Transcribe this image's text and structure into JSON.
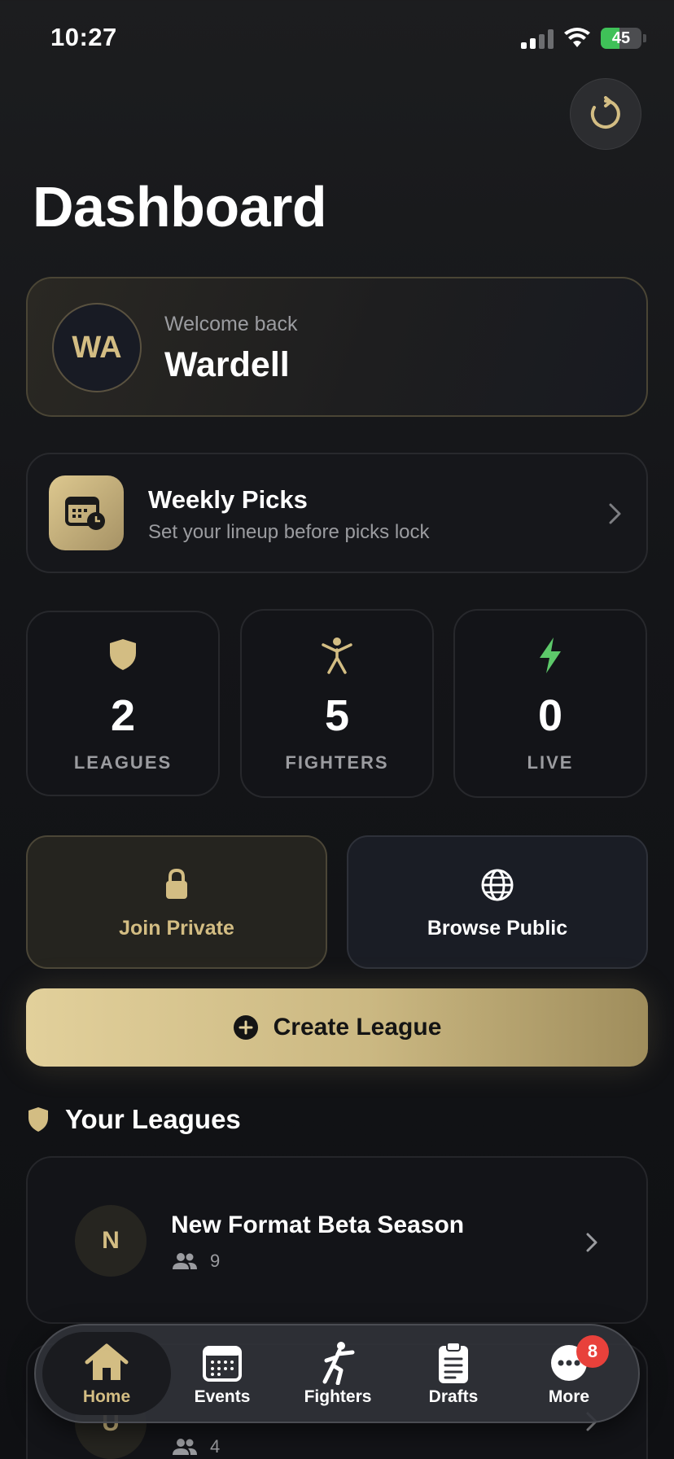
{
  "status_bar": {
    "time": "10:27",
    "battery": "45",
    "battery_level": 0.45
  },
  "header": {
    "title": "Dashboard",
    "refresh_icon": "refresh-icon"
  },
  "welcome": {
    "initials": "WA",
    "label": "Welcome back",
    "name": "Wardell"
  },
  "weekly_picks": {
    "title": "Weekly Picks",
    "subtitle": "Set your lineup before picks lock",
    "icon": "calendar-clock-icon"
  },
  "stats": [
    {
      "value": "2",
      "label": "LEAGUES",
      "icon": "shield-icon",
      "color": "#d3bd83"
    },
    {
      "value": "5",
      "label": "FIGHTERS",
      "icon": "person-icon",
      "color": "#d3bd83"
    },
    {
      "value": "0",
      "label": "LIVE",
      "icon": "bolt-icon",
      "color": "#5dc86a"
    }
  ],
  "actions": {
    "join_private": "Join Private",
    "browse_public": "Browse Public",
    "create_league": "Create League"
  },
  "leagues_section": {
    "title": "Your Leagues",
    "items": [
      {
        "initial": "N",
        "name": "New Format Beta Season",
        "members": "9"
      },
      {
        "initial": "U",
        "name": "",
        "members": "4"
      }
    ]
  },
  "tabbar": {
    "tabs": [
      {
        "label": "Home",
        "icon": "home-icon",
        "active": true
      },
      {
        "label": "Events",
        "icon": "calendar-icon"
      },
      {
        "label": "Fighters",
        "icon": "fighter-icon"
      },
      {
        "label": "Drafts",
        "icon": "clipboard-icon"
      },
      {
        "label": "More",
        "icon": "more-icon",
        "badge": "8"
      }
    ]
  },
  "colors": {
    "accent": "#d3bd83",
    "live": "#5dc86a",
    "badge": "#e8413b"
  }
}
